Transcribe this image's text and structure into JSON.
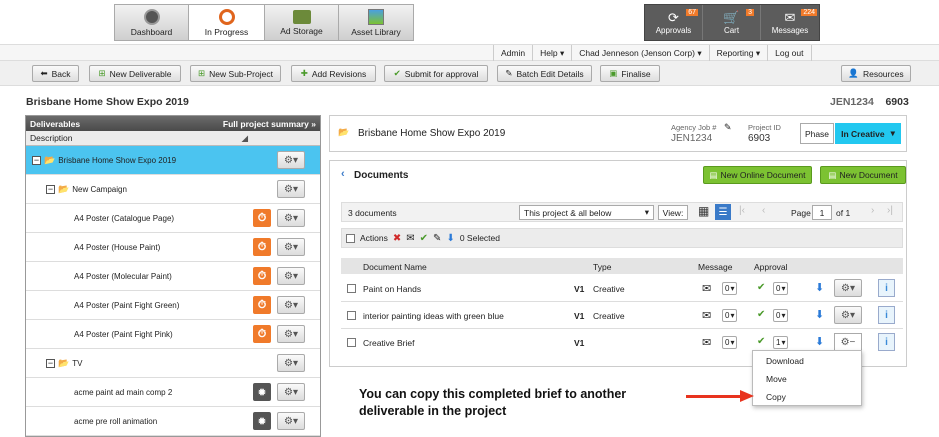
{
  "nav": {
    "tabs": [
      {
        "label": "Dashboard"
      },
      {
        "label": "In Progress"
      },
      {
        "label": "Ad Storage"
      },
      {
        "label": "Asset Library"
      }
    ],
    "right": [
      {
        "label": "Approvals",
        "badge": "67"
      },
      {
        "label": "Cart",
        "badge": "3"
      },
      {
        "label": "Messages",
        "badge": "224"
      }
    ]
  },
  "usermenu": {
    "admin": "Admin",
    "help": "Help",
    "user": "Chad Jenneson (Jenson Corp)",
    "reporting": "Reporting",
    "logout": "Log out"
  },
  "toolbar": {
    "back": "Back",
    "new_deliverable": "New Deliverable",
    "new_subproject": "New Sub-Project",
    "add_revisions": "Add Revisions",
    "submit": "Submit for approval",
    "batch_edit": "Batch Edit Details",
    "finalise": "Finalise",
    "resources": "Resources"
  },
  "page": {
    "title": "Brisbane Home Show Expo 2019",
    "job_code": "JEN1234",
    "project_id_value": "6903"
  },
  "left": {
    "header": "Deliverables",
    "summary": "Full project summary",
    "col": "Description",
    "rows": [
      {
        "label": "Brisbane Home Show Expo 2019"
      },
      {
        "label": "New Campaign"
      },
      {
        "label": "A4 Poster (Catalogue Page)"
      },
      {
        "label": "A4 Poster (House Paint)"
      },
      {
        "label": "A4 Poster (Molecular Paint)"
      },
      {
        "label": "A4 Poster (Paint Fight Green)"
      },
      {
        "label": "A4 Poster (Paint Fight Pink)"
      },
      {
        "label": "TV"
      },
      {
        "label": "acme paint ad main comp 2"
      },
      {
        "label": "acme pre roll animation"
      }
    ]
  },
  "project": {
    "title": "Brisbane Home Show Expo 2019",
    "agency_label": "Agency Job #",
    "agency_value": "JEN1234",
    "pid_label": "Project ID",
    "pid_value": "6903",
    "phase_label": "Phase",
    "phase_value": "In Creative"
  },
  "docs": {
    "title": "Documents",
    "new_online": "New Online Document",
    "new_doc": "New Document",
    "count": "3 documents",
    "filter": "This project & all below",
    "view_label": "View:",
    "page_label": "Page",
    "page_value": "1",
    "page_of": "of 1",
    "actions": "Actions",
    "selected": "0 Selected",
    "cols": {
      "name": "Document Name",
      "type": "Type",
      "message": "Message",
      "approval": "Approval"
    },
    "rows": [
      {
        "name": "Paint on Hands",
        "ver": "V1",
        "type": "Creative",
        "msg": "0",
        "appr": "0"
      },
      {
        "name": "interior painting ideas with green blue",
        "ver": "V1",
        "type": "Creative",
        "msg": "0",
        "appr": "0"
      },
      {
        "name": "Creative Brief",
        "ver": "V1",
        "type": "",
        "msg": "0",
        "appr": "1"
      }
    ]
  },
  "menu": {
    "items": [
      "Download",
      "Move",
      "Copy"
    ]
  },
  "annotation": {
    "line1": "You can copy this completed brief to another",
    "line2": "deliverable in the project"
  },
  "colors": {
    "accent_cyan": "#22c8f0",
    "green": "#7cc232",
    "orange": "#f07a2a",
    "nav_dark": "#5c5c5c",
    "arrow_red": "#e8331e"
  }
}
